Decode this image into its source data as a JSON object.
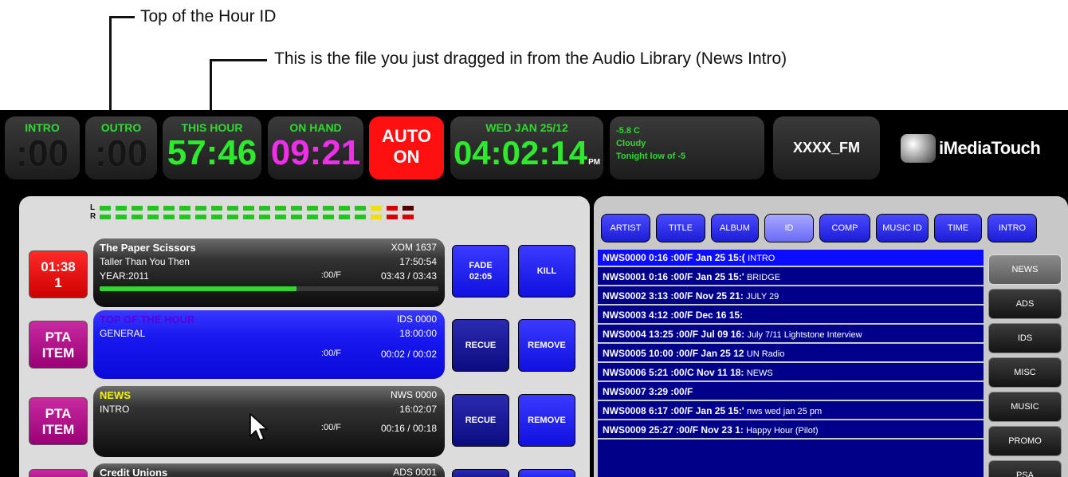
{
  "annotations": {
    "callout1": "Top of the Hour ID",
    "callout2": "This is the file you just dragged in from the Audio Library (News Intro)"
  },
  "topbar": {
    "intro": {
      "label": "INTRO",
      "value": ":00"
    },
    "outro": {
      "label": "OUTRO",
      "value": ":00"
    },
    "this_hour": {
      "label": "THIS HOUR",
      "value": "57:46"
    },
    "on_hand": {
      "label": "ON HAND",
      "value": "09:21"
    },
    "auto": {
      "line1": "AUTO",
      "line2": "ON"
    },
    "clock": {
      "date": "WED JAN 25/12",
      "time": "04:02:14",
      "ampm": "PM"
    },
    "weather": {
      "temp": "-5.8 C",
      "condition": "Cloudy",
      "forecast": "Tonight low of -5"
    },
    "station": "XXXX_FM",
    "brand": "iMediaTouch"
  },
  "vu": {
    "left_label": "L",
    "right_label": "R"
  },
  "playlist": [
    {
      "time_line1": "01:38",
      "time_line2": "1",
      "title": "The Paper Scissors",
      "code": "XOM 1637",
      "subtitle": "Taller Than You Then",
      "start": "17:50:54",
      "year": "YEAR:2011",
      "marker": ":00/F",
      "duration": "03:43 / 03:43",
      "progress": 0.58,
      "btn1_line1": "FADE",
      "btn1_line2": "02:05",
      "btn2": "KILL"
    },
    {
      "time_line1": "PTA",
      "time_line2": "ITEM",
      "title": "TOP OF THE HOUR",
      "code": "IDS 0000",
      "subtitle": "GENERAL",
      "start": "18:00:00",
      "marker": ":00/F",
      "duration": "00:02 / 00:02",
      "btn1": "RECUE",
      "btn2": "REMOVE"
    },
    {
      "time_line1": "PTA",
      "time_line2": "ITEM",
      "title": "NEWS",
      "code": "NWS 0000",
      "subtitle": "INTRO",
      "start": "16:02:07",
      "marker": ":00/F",
      "duration": "00:16 / 00:18",
      "btn1": "RECUE",
      "btn2": "REMOVE"
    },
    {
      "title": "Credit Unions",
      "code": "ADS 0001"
    }
  ],
  "library": {
    "tabs": [
      "ARTIST",
      "TITLE",
      "ALBUM",
      "ID",
      "COMP",
      "MUSIC ID",
      "TIME",
      "INTRO"
    ],
    "active_tab": "ID",
    "rows": [
      {
        "main": "NWS0000 0:16 :00/F  Jan 25 15:(",
        "desc": "INTRO"
      },
      {
        "main": "NWS0001 0:16 :00/F  Jan 25 15:'",
        "desc": "BRIDGE"
      },
      {
        "main": "NWS0002 3:13 :00/F  Nov 25 21:",
        "desc": "JULY 29"
      },
      {
        "main": "NWS0003 4:12 :00/F  Dec 16 15:",
        "desc": ""
      },
      {
        "main": "NWS0004 13:25 :00/F  Jul 09 16:",
        "desc": "July 7/11 Lightstone Interview"
      },
      {
        "main": "NWS0005 10:00 :00/F  Jan 25 12",
        "desc": "UN Radio"
      },
      {
        "main": "NWS0006 5:21 :00/C  Nov 11 18:",
        "desc": "NEWS"
      },
      {
        "main": "NWS0007 3:29 :00/F",
        "desc": ""
      },
      {
        "main": "NWS0008 6:17 :00/F  Jan 25 15:'",
        "desc": "nws wed jan 25 pm"
      },
      {
        "main": "NWS0009 25:27 :00/F  Nov 23 1:",
        "desc": "Happy Hour (Pilot)"
      }
    ],
    "categories": [
      "NEWS",
      "ADS",
      "IDS",
      "MISC",
      "MUSIC",
      "PROMO",
      "PSA"
    ],
    "active_category": "NEWS"
  }
}
